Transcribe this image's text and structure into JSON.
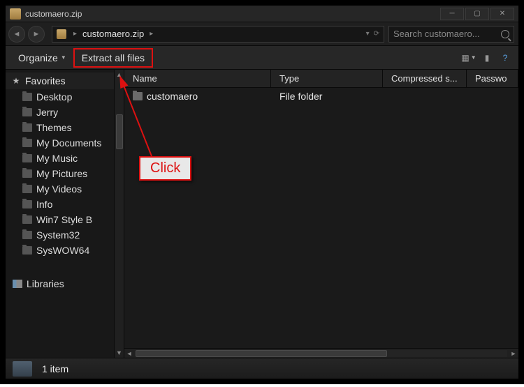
{
  "window": {
    "title": "customaero.zip"
  },
  "address": {
    "crumb": "customaero.zip"
  },
  "search": {
    "placeholder": "Search customaero..."
  },
  "toolbar": {
    "organize": "Organize",
    "extract": "Extract all files"
  },
  "sidebar": {
    "favorites_label": "Favorites",
    "libraries_label": "Libraries",
    "favorites": [
      {
        "label": "Desktop"
      },
      {
        "label": "Jerry"
      },
      {
        "label": "Themes"
      },
      {
        "label": "My Documents"
      },
      {
        "label": "My Music"
      },
      {
        "label": "My Pictures"
      },
      {
        "label": "My Videos"
      },
      {
        "label": "Info"
      },
      {
        "label": "Win7 Style B"
      },
      {
        "label": "System32"
      },
      {
        "label": "SysWOW64"
      }
    ]
  },
  "columns": {
    "name": "Name",
    "type": "Type",
    "compressed": "Compressed s...",
    "password": "Passwo"
  },
  "rows": [
    {
      "name": "customaero",
      "type": "File folder",
      "compressed": "",
      "password": ""
    }
  ],
  "status": {
    "text": "1 item"
  },
  "annotation": {
    "label": "Click"
  }
}
